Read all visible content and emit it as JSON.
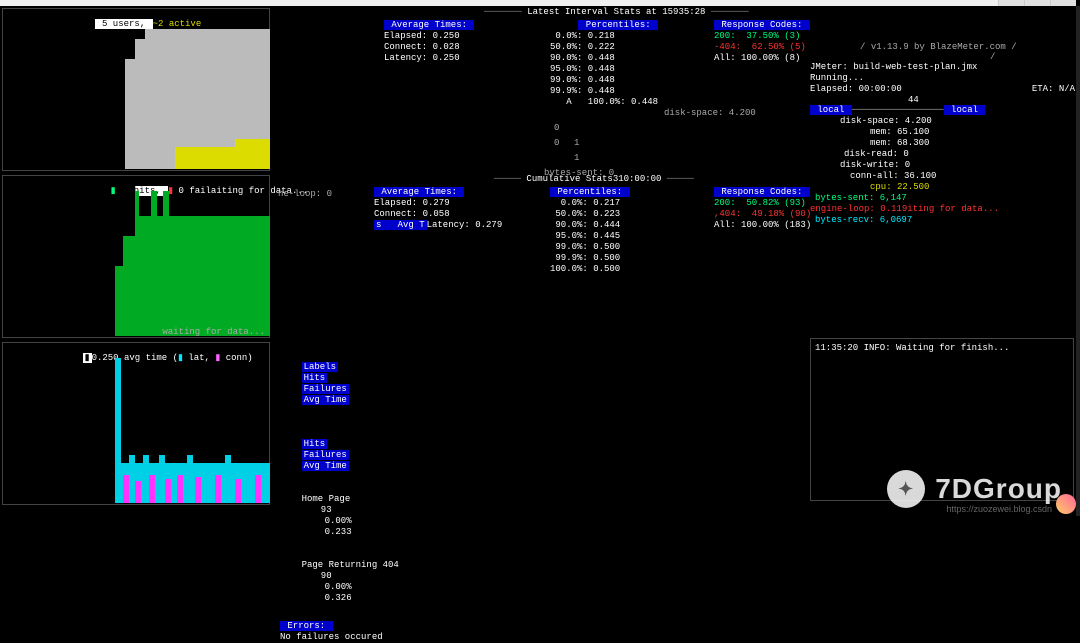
{
  "app": {
    "version": "v1.13.9 by BlazeMeter.com",
    "jmeter_line": "JMeter: build-web-test-plan.jmx",
    "running": "Running...",
    "elapsed": "Elapsed: 00:00:00",
    "eta": "ETA: N/A",
    "count": "44"
  },
  "users_panel": {
    "title": " 5 users, ",
    "active": "~2 active"
  },
  "hits_panel": {
    "hits": "01 hits, ",
    "fail": " 0 failaiting for data...",
    "waiting": "waiting for data..."
  },
  "time_panel": {
    "title": "0.250 avg time (",
    "lat": " lat, ",
    "conn": " conn)"
  },
  "latest_interval": {
    "title": " Latest Interval Stats at 15935:28 ",
    "avg_times_header": " Average Times: ",
    "avg_times": [
      "Elapsed: 0.250",
      "Connect: 0.028",
      "Latency: 0.250"
    ],
    "percentiles_header": " Percentiles: ",
    "percentiles": [
      " 0.0%: 0.218",
      "50.0%: 0.222",
      "90.0%: 0.448",
      "95.0%: 0.448",
      "99.0%: 0.448",
      "99.9%: 0.448",
      "   A   100.0%: 0.448"
    ],
    "response_codes_header": " Response Codes: ",
    "rc200": "200:  37.50% (3)",
    "rc404": "-404:  62.50% (5)",
    "rc_all": "All: 100.00% (8)",
    "disk_space": "disk-space: 4.200",
    "bytes_sent": "bytes-sent: 0",
    "zeros": [
      "0",
      "0",
      "1",
      "1"
    ]
  },
  "cumulative": {
    "title": " Cumulative Stats310:00:00 ",
    "ne_loop": "ne-loop: 0",
    "avg_times_header": " Average Times: ",
    "avg_times": [
      "Elapsed: 0.279",
      "Connect: 0.058",
      "Latency: 0.279"
    ],
    "avg_t_prefix": "s   Avg T",
    "percentiles_header": " Percentiles: ",
    "percentiles": [
      "  0.0%: 0.217",
      " 50.0%: 0.223",
      " 90.0%: 0.444",
      " 95.0%: 0.445",
      " 99.0%: 0.500",
      " 99.9%: 0.500",
      "100.0%: 0.500"
    ],
    "response_codes_header": " Response Codes: ",
    "rc200": "200:  50.82% (93)",
    "rc404": ",404:  49.18% (90)",
    "rc_all": "All: 100.00% (183)"
  },
  "local": {
    "badge_left": " local ",
    "badge_right": " local ",
    "lines": {
      "disk_space": "disk-space: 4.200",
      "mem1": "mem: 65.100",
      "mem2": "mem: 68.300",
      "disk_read": "disk-read: 0",
      "disk_write": "disk-write: 0",
      "conn_all": "conn-all: 36.100",
      "cpu": "cpu: 22.500",
      "bytes_sent": "bytes-sent: 6,147",
      "engine_loop": "engine-loop: 0.119iting for data...",
      "bytes_recv": "bytes-recv: 6,0697"
    }
  },
  "table": {
    "headers": [
      "Labels",
      "Hits",
      "Failures",
      "Avg Time"
    ],
    "subheaders": [
      "Hits",
      "Failures",
      "Avg Time"
    ],
    "rows": [
      {
        "label": "Home Page",
        "hits": "93",
        "failures": "0.00%",
        "avg": "0.233"
      },
      {
        "label": "Page Returning 404",
        "hits": "90",
        "failures": "0.00%",
        "avg": "0.326"
      }
    ],
    "errors_header": " Errors: ",
    "errors_msg": "No failures occured"
  },
  "log": {
    "line": "11:35:20 INFO: Waiting for finish..."
  },
  "watermark": "7DGroup",
  "url": "https://zuozewei.blog.csdn",
  "chart_data": [
    {
      "type": "bar",
      "name": "users",
      "x": "time",
      "series": [
        {
          "name": "gray-fill",
          "color": "#bbbbbb",
          "values": [
            80,
            100,
            100,
            100,
            100,
            100,
            100,
            100,
            100,
            100,
            100,
            100,
            100,
            100,
            100
          ]
        },
        {
          "name": "yellow-active",
          "color": "#dcdc00",
          "values": [
            0,
            0,
            0,
            0,
            0,
            0,
            15,
            15,
            15,
            15,
            15,
            15,
            20,
            20,
            20
          ]
        }
      ]
    },
    {
      "type": "bar",
      "name": "hits",
      "series": [
        {
          "name": "green-hits",
          "color": "#00cc33",
          "values": [
            120,
            40,
            120,
            120,
            40,
            120,
            120,
            40,
            100,
            100,
            100,
            100,
            100,
            100,
            100,
            100,
            100,
            100,
            100,
            100,
            100,
            100,
            100,
            100,
            100
          ]
        },
        {
          "name": "red-fail",
          "color": "#ff3333",
          "values": [
            0,
            0,
            0,
            0,
            0,
            0,
            0,
            0,
            0,
            0,
            0,
            0,
            0,
            0,
            0,
            0,
            0,
            0,
            0,
            0,
            0,
            0,
            0,
            0,
            0
          ]
        }
      ]
    },
    {
      "type": "bar",
      "name": "avg-time",
      "series": [
        {
          "name": "cyan-lat",
          "color": "#00eaff",
          "values": [
            140,
            40,
            40,
            40,
            40,
            40,
            40,
            35,
            35,
            35,
            35,
            35,
            35,
            35,
            35,
            35,
            35,
            35,
            35,
            35,
            35,
            35,
            35,
            35,
            35
          ]
        },
        {
          "name": "magenta-conn",
          "color": "#ff33ff",
          "values": [
            20,
            25,
            18,
            25,
            25,
            18,
            20,
            20,
            18,
            25,
            22,
            20,
            22,
            22,
            20,
            18,
            25,
            22,
            20,
            22,
            22,
            20,
            22,
            18,
            20
          ]
        }
      ]
    }
  ]
}
